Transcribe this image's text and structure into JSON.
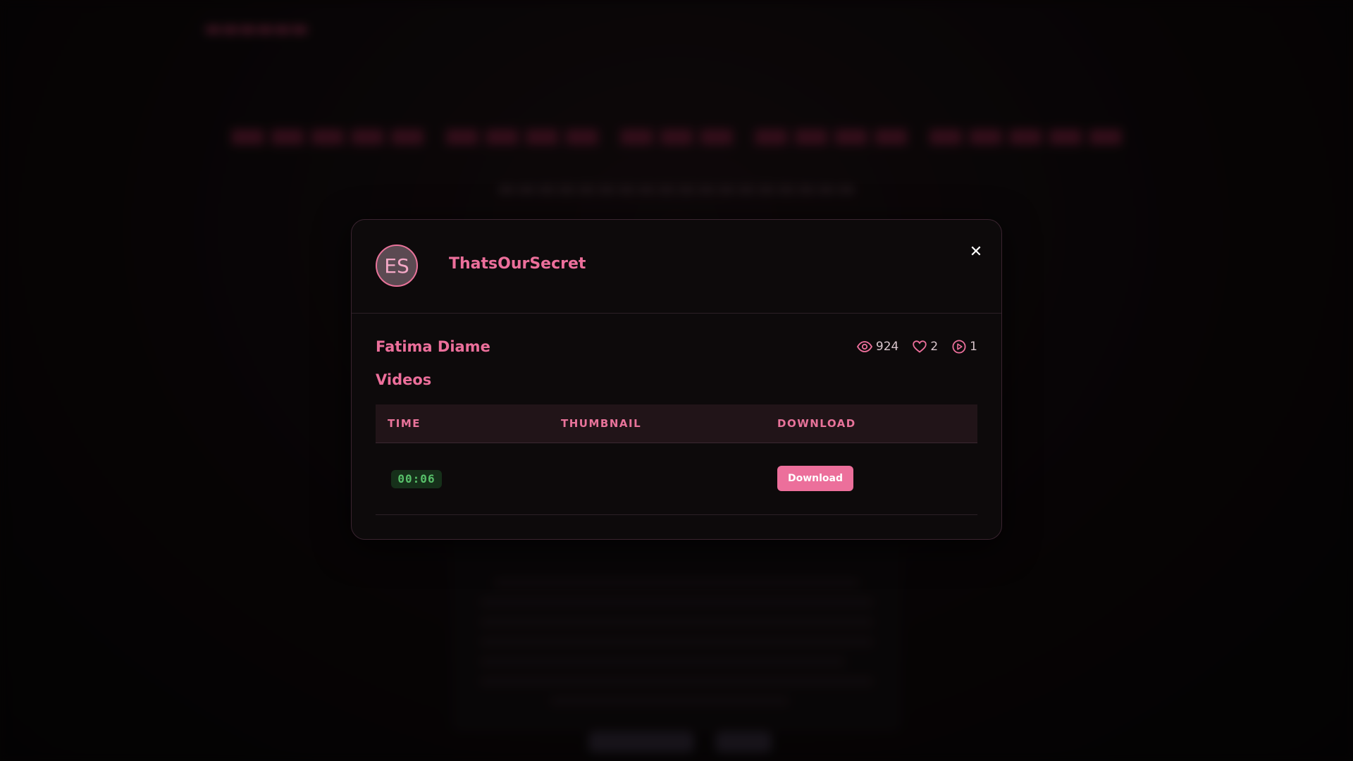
{
  "modal": {
    "avatar_initials": "ES",
    "channel_name": "ThatsOurSecret",
    "close_symbol": "✕",
    "post_title": "Fatima Diame",
    "stats": {
      "views": "924",
      "likes": "2",
      "videos": "1"
    },
    "section_title": "Videos",
    "table": {
      "headers": [
        "TIME",
        "THUMBNAIL",
        "DOWNLOAD"
      ],
      "rows": [
        {
          "time": "00:06",
          "thumbnail": "",
          "download_label": "Download"
        }
      ]
    }
  },
  "icons": {
    "views": "eye-icon",
    "likes": "heart-icon",
    "videos": "play-circle-icon",
    "close": "close-icon"
  },
  "colors": {
    "accent": "#ec6f9b",
    "time_badge_bg": "#16301a",
    "time_badge_text": "#58c06a",
    "modal_bg": "#0d0a0b",
    "header_row_bg": "#211418"
  }
}
